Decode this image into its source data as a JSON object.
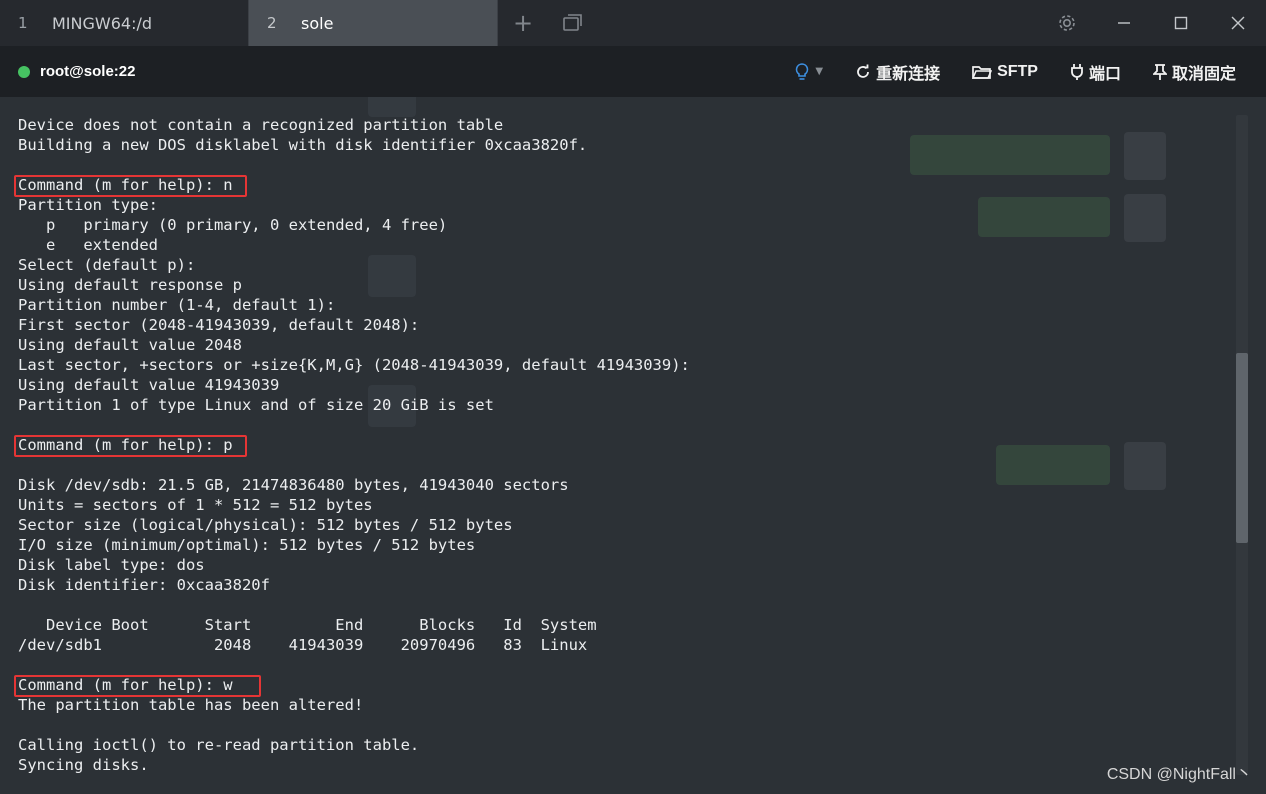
{
  "tabs": [
    {
      "number": "1",
      "label": "MINGW64:/d"
    },
    {
      "number": "2",
      "label": "sole"
    }
  ],
  "tab_tools": {
    "new_tab": "+",
    "tab_overview": "⧉"
  },
  "window": {
    "settings": "⚙",
    "minimize": "—",
    "maximize": "☐",
    "close": "✕"
  },
  "session": {
    "host": "root@sole:22",
    "status_color": "#46c262"
  },
  "toolbar": {
    "reconnect": "重新连接",
    "sftp": "SFTP",
    "port": "端口",
    "unpin": "取消固定"
  },
  "terminal": {
    "lines": [
      "Device does not contain a recognized partition table",
      "Building a new DOS disklabel with disk identifier 0xcaa3820f.",
      "",
      "Command (m for help): n",
      "Partition type:",
      "   p   primary (0 primary, 0 extended, 4 free)",
      "   e   extended",
      "Select (default p):",
      "Using default response p",
      "Partition number (1-4, default 1):",
      "First sector (2048-41943039, default 2048):",
      "Using default value 2048",
      "Last sector, +sectors or +size{K,M,G} (2048-41943039, default 41943039):",
      "Using default value 41943039",
      "Partition 1 of type Linux and of size 20 GiB is set",
      "",
      "Command (m for help): p",
      "",
      "Disk /dev/sdb: 21.5 GB, 21474836480 bytes, 41943040 sectors",
      "Units = sectors of 1 * 512 = 512 bytes",
      "Sector size (logical/physical): 512 bytes / 512 bytes",
      "I/O size (minimum/optimal): 512 bytes / 512 bytes",
      "Disk label type: dos",
      "Disk identifier: 0xcaa3820f",
      "",
      "   Device Boot      Start         End      Blocks   Id  System",
      "/dev/sdb1            2048    41943039    20970496   83  Linux",
      "",
      "Command (m for help): w",
      "The partition table has been altered!",
      "",
      "Calling ioctl() to re-read partition table.",
      "Syncing disks."
    ],
    "highlight_color": "#e53535"
  },
  "watermark": "CSDN @NightFall丶"
}
